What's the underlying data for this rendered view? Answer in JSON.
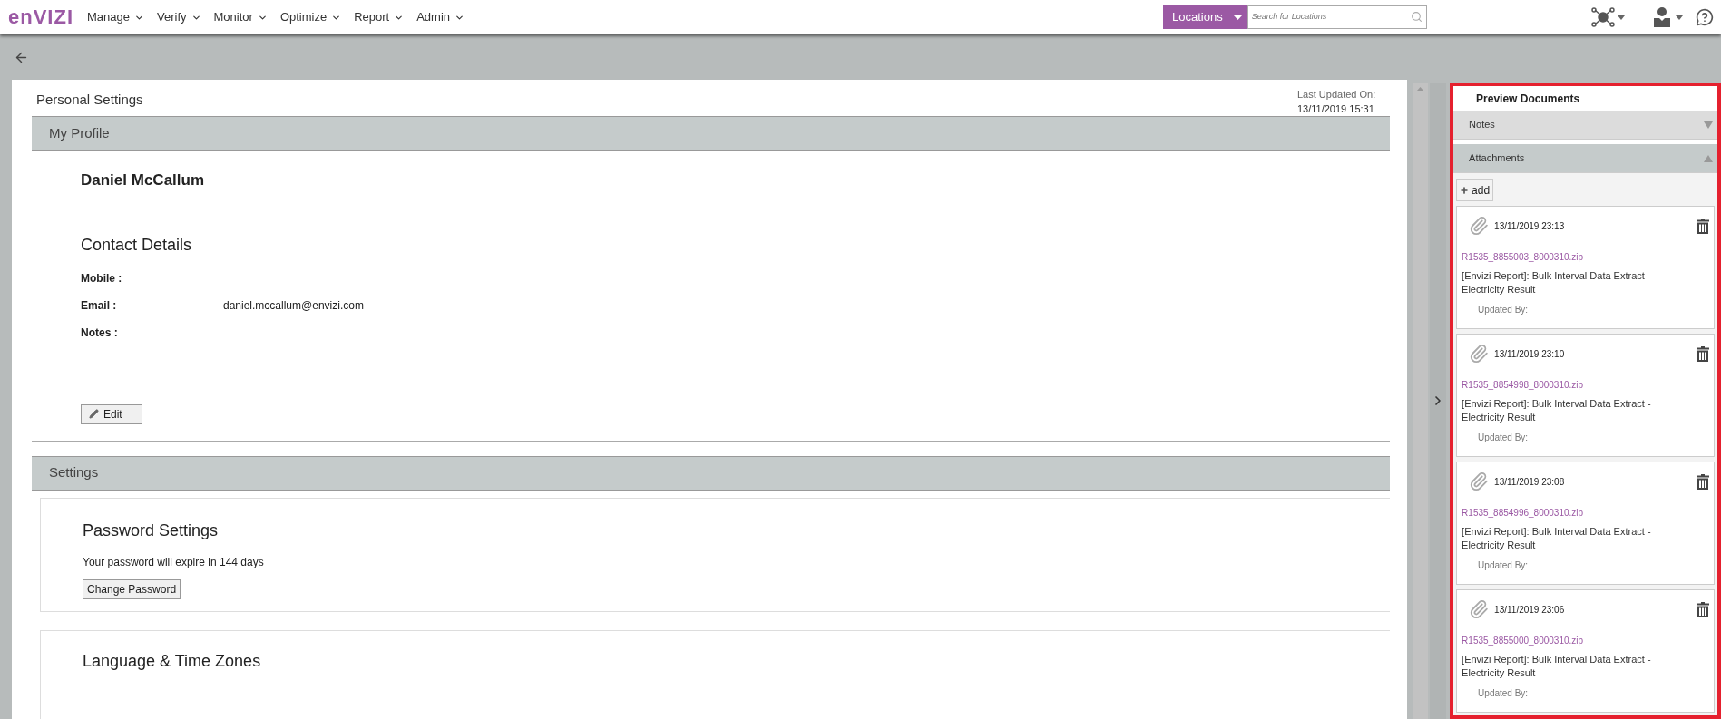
{
  "nav": {
    "logo": "enVIZI",
    "menus": [
      {
        "label": "Manage"
      },
      {
        "label": "Verify"
      },
      {
        "label": "Monitor"
      },
      {
        "label": "Optimize"
      },
      {
        "label": "Report"
      },
      {
        "label": "Admin"
      }
    ],
    "location_button": "Locations",
    "search": {
      "placeholder": "Search for Locations"
    }
  },
  "page": {
    "title": "Personal Settings",
    "last_updated_label": "Last Updated On:",
    "last_updated_value": "13/11/2019 15:31"
  },
  "profile": {
    "header": "My Profile",
    "name": "Daniel McCallum",
    "contact_title": "Contact Details",
    "fields": [
      {
        "label": "Mobile :"
      },
      {
        "label": "Email :",
        "value": "daniel.mccallum@envizi.com"
      },
      {
        "label": "Notes :"
      }
    ],
    "edit_button": "Edit"
  },
  "settings": {
    "header": "Settings",
    "password": {
      "title": "Password Settings",
      "message": "Your password will expire in 144 days",
      "button": "Change Password"
    },
    "language": {
      "title": "Language & Time Zones"
    }
  },
  "preview": {
    "title": "Preview Documents",
    "sections": [
      {
        "label": "Notes",
        "expanded": false
      },
      {
        "label": "Attachments",
        "expanded": true
      }
    ],
    "add_button": "add",
    "attachments": [
      {
        "date": "13/11/2019 23:13",
        "file": "R1535_8855003_8000310.zip",
        "description": "[Envizi Report]: Bulk Interval Data Extract - Electricity Result",
        "updated_by": "Updated By:"
      },
      {
        "date": "13/11/2019 23:10",
        "file": "R1535_8854998_8000310.zip",
        "description": "[Envizi Report]: Bulk Interval Data Extract - Electricity Result",
        "updated_by": "Updated By:"
      },
      {
        "date": "13/11/2019 23:08",
        "file": "R1535_8854996_8000310.zip",
        "description": "[Envizi Report]: Bulk Interval Data Extract - Electricity Result",
        "updated_by": "Updated By:"
      },
      {
        "date": "13/11/2019 23:06",
        "file": "R1535_8855000_8000310.zip",
        "description": "[Envizi Report]: Bulk Interval Data Extract - Electricity Result",
        "updated_by": "Updated By:"
      }
    ]
  }
}
